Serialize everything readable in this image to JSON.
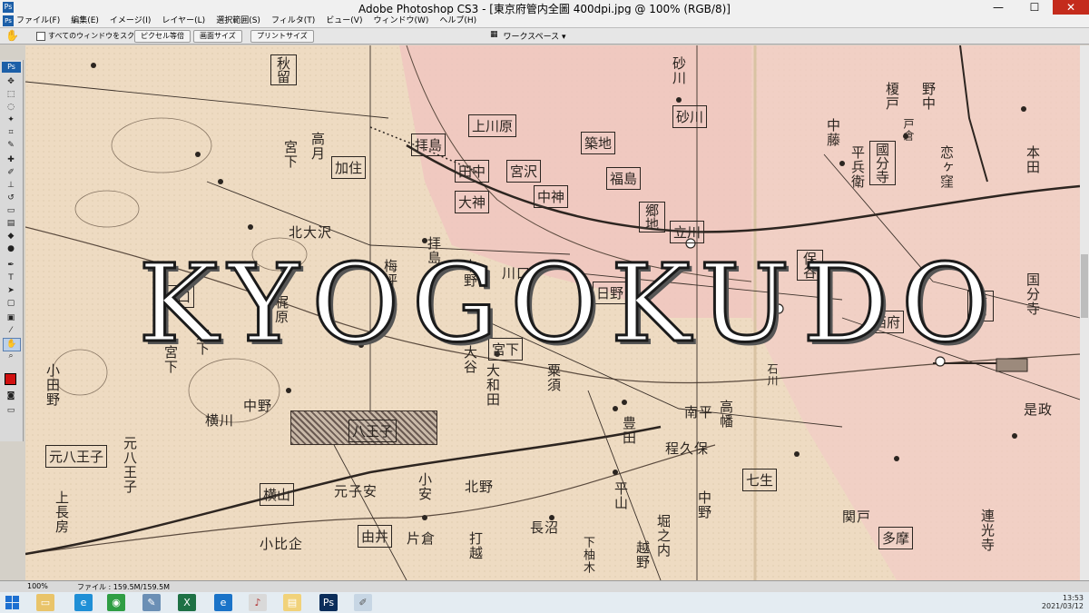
{
  "window": {
    "title": "Adobe Photoshop CS3 - [東京府管内全圖 400dpi.jpg @ 100% (RGB/8)]",
    "app_icon": "Ps",
    "minimize": "—",
    "maximize": "☐",
    "close": "✕"
  },
  "menu": {
    "items": [
      "ファイル(F)",
      "編集(E)",
      "イメージ(I)",
      "レイヤー(L)",
      "選択範囲(S)",
      "フィルタ(T)",
      "ビュー(V)",
      "ウィンドウ(W)",
      "ヘルプ(H)"
    ]
  },
  "options": {
    "scroll_all_label": "すべてのウィンドウをスクロール",
    "actual_pixels": "ピクセル等倍",
    "fit_screen": "画面サイズ",
    "print_size": "プリントサイズ",
    "workspace": "ワークスペース ▾"
  },
  "tools": {
    "ps_tab": "Ps"
  },
  "map": {
    "watermark": "KYOGOKUDO",
    "labels": [
      {
        "text": "八王子",
        "type": "box"
      },
      {
        "text": "立川",
        "type": "box"
      },
      {
        "text": "府中",
        "type": "box"
      },
      {
        "text": "國分寺",
        "type": "box"
      },
      {
        "text": "砂川",
        "type": "box"
      },
      {
        "text": "中神",
        "type": "box"
      },
      {
        "text": "福島",
        "type": "box"
      },
      {
        "text": "拝島",
        "type": "box"
      },
      {
        "text": "田中",
        "type": "box"
      },
      {
        "text": "宮沢",
        "type": "box"
      },
      {
        "text": "大神",
        "type": "box"
      },
      {
        "text": "上川原",
        "type": "box"
      },
      {
        "text": "築地",
        "type": "box"
      },
      {
        "text": "加住",
        "type": "box"
      },
      {
        "text": "川口",
        "type": "box"
      },
      {
        "text": "日野",
        "type": "box"
      },
      {
        "text": "宮下",
        "type": "box"
      },
      {
        "text": "保谷",
        "type": "box"
      },
      {
        "text": "西府",
        "type": "box"
      },
      {
        "text": "元八王子",
        "type": "box"
      },
      {
        "text": "横山",
        "type": "box"
      },
      {
        "text": "由井",
        "type": "box"
      },
      {
        "text": "七生",
        "type": "box"
      },
      {
        "text": "多摩",
        "type": "box"
      },
      {
        "text": "秋留",
        "type": "box"
      },
      {
        "text": "郷地",
        "type": "box"
      },
      {
        "text": "拝島",
        "type": "plain"
      },
      {
        "text": "高月",
        "type": "plain"
      },
      {
        "text": "宮下",
        "type": "plain"
      },
      {
        "text": "北大沢",
        "type": "plain"
      },
      {
        "text": "平山",
        "type": "plain"
      },
      {
        "text": "中野",
        "type": "plain"
      },
      {
        "text": "南平",
        "type": "plain"
      },
      {
        "text": "高幡",
        "type": "plain"
      },
      {
        "text": "程久保",
        "type": "plain"
      },
      {
        "text": "連光寺",
        "type": "plain"
      },
      {
        "text": "関戸",
        "type": "plain"
      },
      {
        "text": "是政",
        "type": "plain"
      },
      {
        "text": "国分寺",
        "type": "plain"
      },
      {
        "text": "本田",
        "type": "plain"
      },
      {
        "text": "恋ヶ窪",
        "type": "plain"
      },
      {
        "text": "平兵衛",
        "type": "plain"
      },
      {
        "text": "上長房",
        "type": "plain"
      },
      {
        "text": "元八王子",
        "type": "plain"
      },
      {
        "text": "横川",
        "type": "plain"
      },
      {
        "text": "中野",
        "type": "plain"
      },
      {
        "text": "小比企",
        "type": "plain"
      },
      {
        "text": "片倉",
        "type": "plain"
      },
      {
        "text": "長沼",
        "type": "plain"
      },
      {
        "text": "越野",
        "type": "plain"
      },
      {
        "text": "堀之内",
        "type": "plain"
      },
      {
        "text": "下柚木",
        "type": "plain"
      },
      {
        "text": "打越",
        "type": "plain"
      },
      {
        "text": "小安",
        "type": "plain"
      },
      {
        "text": "元子安",
        "type": "plain"
      },
      {
        "text": "北野",
        "type": "plain"
      },
      {
        "text": "豊田",
        "type": "plain"
      },
      {
        "text": "大和田",
        "type": "plain"
      },
      {
        "text": "粟須",
        "type": "plain"
      },
      {
        "text": "石川",
        "type": "plain"
      },
      {
        "text": "梅坪",
        "type": "plain"
      },
      {
        "text": "中野",
        "type": "plain"
      },
      {
        "text": "大谷",
        "type": "plain"
      },
      {
        "text": "川口",
        "type": "plain"
      },
      {
        "text": "宮下",
        "type": "plain"
      },
      {
        "text": "方下",
        "type": "plain"
      },
      {
        "text": "小田野",
        "type": "plain"
      },
      {
        "text": "梶原",
        "type": "plain"
      },
      {
        "text": "砂川",
        "type": "plain"
      },
      {
        "text": "野中",
        "type": "plain"
      },
      {
        "text": "戸倉",
        "type": "plain"
      },
      {
        "text": "中藤",
        "type": "plain"
      },
      {
        "text": "榎戸",
        "type": "plain"
      }
    ]
  },
  "status": {
    "zoom": "100%",
    "file_info": "ファイル : 159.5M/159.5M"
  },
  "taskbar": {
    "time": "13:53",
    "date": "2021/03/12"
  }
}
